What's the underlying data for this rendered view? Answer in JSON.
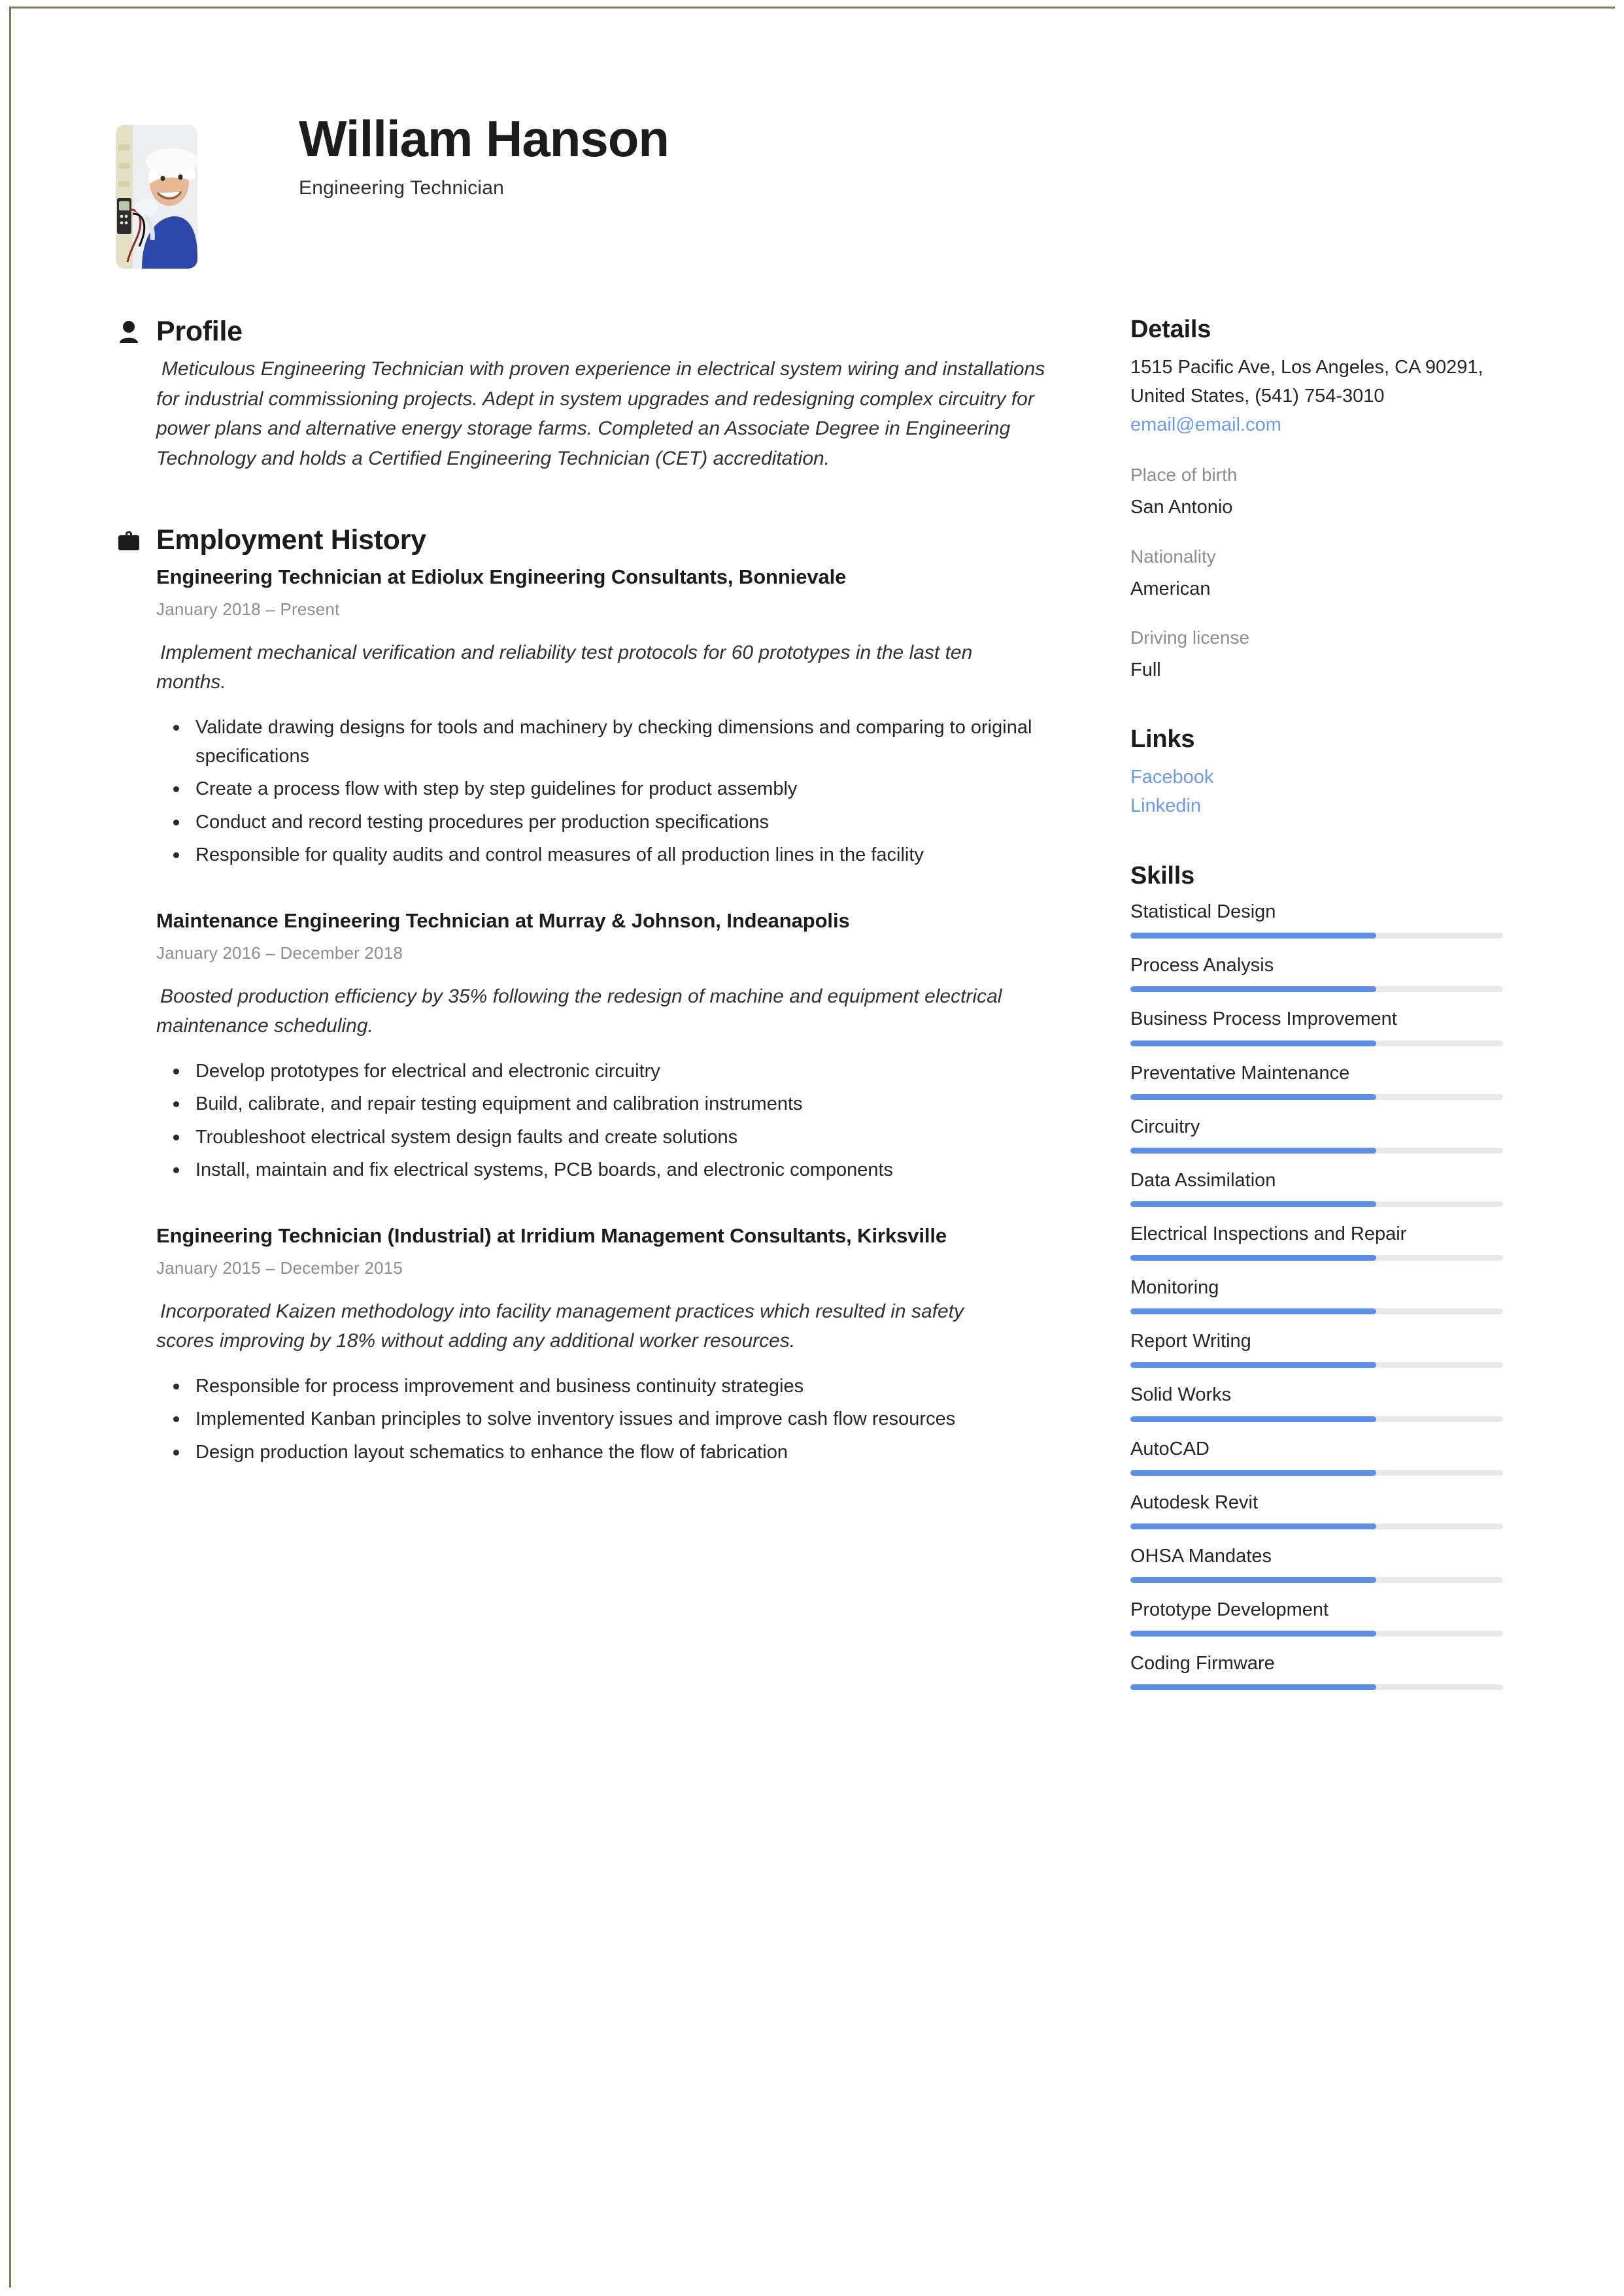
{
  "document": {
    "border_color": "#7e7b5b",
    "accent_color": "#5d8fe8",
    "link_color": "#6c9ae8"
  },
  "header": {
    "full_name": "William Hanson",
    "job_title": "Engineering Technician",
    "avatar_alt": "photo of engineering technician in white hard hat holding a multimeter"
  },
  "profile": {
    "icon": "person-icon",
    "title": "Profile",
    "text": "Meticulous Engineering Technician with proven experience in electrical system wiring and installations for industrial commissioning projects. Adept in system upgrades and redesigning complex circuitry for power plans and alternative energy storage farms. Completed an Associate Degree in Engineering Technology and holds a Certified Engineering Technician (CET) accreditation."
  },
  "employment": {
    "icon": "briefcase-icon",
    "title": "Employment History",
    "jobs": [
      {
        "heading": "Engineering Technician at Ediolux Engineering Consultants, Bonnievale",
        "dates": "January 2018  –  Present",
        "summary": "Implement mechanical verification and reliability test protocols for 60 prototypes in the last ten months.",
        "bullets": [
          "Validate drawing designs for tools and machinery by checking dimensions and comparing to original specifications",
          "Create a process flow with step by step guidelines for product assembly",
          "Conduct and record testing procedures per production specifications",
          "Responsible for quality audits and control measures of all production lines in the facility"
        ]
      },
      {
        "heading": "Maintenance Engineering Technician at Murray & Johnson, Indeanapolis",
        "dates": "January 2016  –  December 2018",
        "summary": "Boosted production efficiency by 35% following the redesign of machine and equipment electrical maintenance scheduling.",
        "bullets": [
          "Develop prototypes for electrical and electronic circuitry",
          "Build, calibrate, and repair testing equipment and calibration instruments",
          "Troubleshoot electrical system design faults and create solutions",
          "Install, maintain and fix electrical systems, PCB boards, and electronic components"
        ]
      },
      {
        "heading": "Engineering Technician (Industrial) at Irridium Management Consultants, Kirksville",
        "dates": "January 2015  –  December 2015",
        "summary": "Incorporated Kaizen methodology into facility management practices which resulted in safety scores improving by 18% without adding any additional worker resources.",
        "bullets": [
          "Responsible for process improvement and business continuity strategies",
          "Implemented Kanban principles to solve inventory issues and improve cash flow resources",
          "Design production layout schematics to enhance the flow of fabrication"
        ]
      }
    ]
  },
  "details": {
    "title": "Details",
    "address": "1515 Pacific Ave, Los Angeles, CA 90291, United States, (541) 754-3010",
    "email": "email@email.com",
    "fields": [
      {
        "label": "Place of birth",
        "value": "San Antonio"
      },
      {
        "label": "Nationality",
        "value": "American"
      },
      {
        "label": "Driving license",
        "value": "Full"
      }
    ]
  },
  "links": {
    "title": "Links",
    "items": [
      {
        "label": "Facebook"
      },
      {
        "label": "Linkedin"
      }
    ]
  },
  "skills": {
    "title": "Skills",
    "items": [
      {
        "name": "Statistical Design",
        "level": 66
      },
      {
        "name": "Process Analysis",
        "level": 66
      },
      {
        "name": "Business Process Improvement",
        "level": 66
      },
      {
        "name": "Preventative Maintenance",
        "level": 66
      },
      {
        "name": "Circuitry",
        "level": 66
      },
      {
        "name": "Data Assimilation",
        "level": 66
      },
      {
        "name": "Electrical Inspections and Repair",
        "level": 66
      },
      {
        "name": "Monitoring",
        "level": 66
      },
      {
        "name": "Report Writing",
        "level": 66
      },
      {
        "name": "Solid Works",
        "level": 66
      },
      {
        "name": "AutoCAD",
        "level": 66
      },
      {
        "name": "Autodesk Revit",
        "level": 66
      },
      {
        "name": "OHSA Mandates",
        "level": 66
      },
      {
        "name": "Prototype Development",
        "level": 66
      },
      {
        "name": "Coding Firmware",
        "level": 66
      }
    ]
  }
}
